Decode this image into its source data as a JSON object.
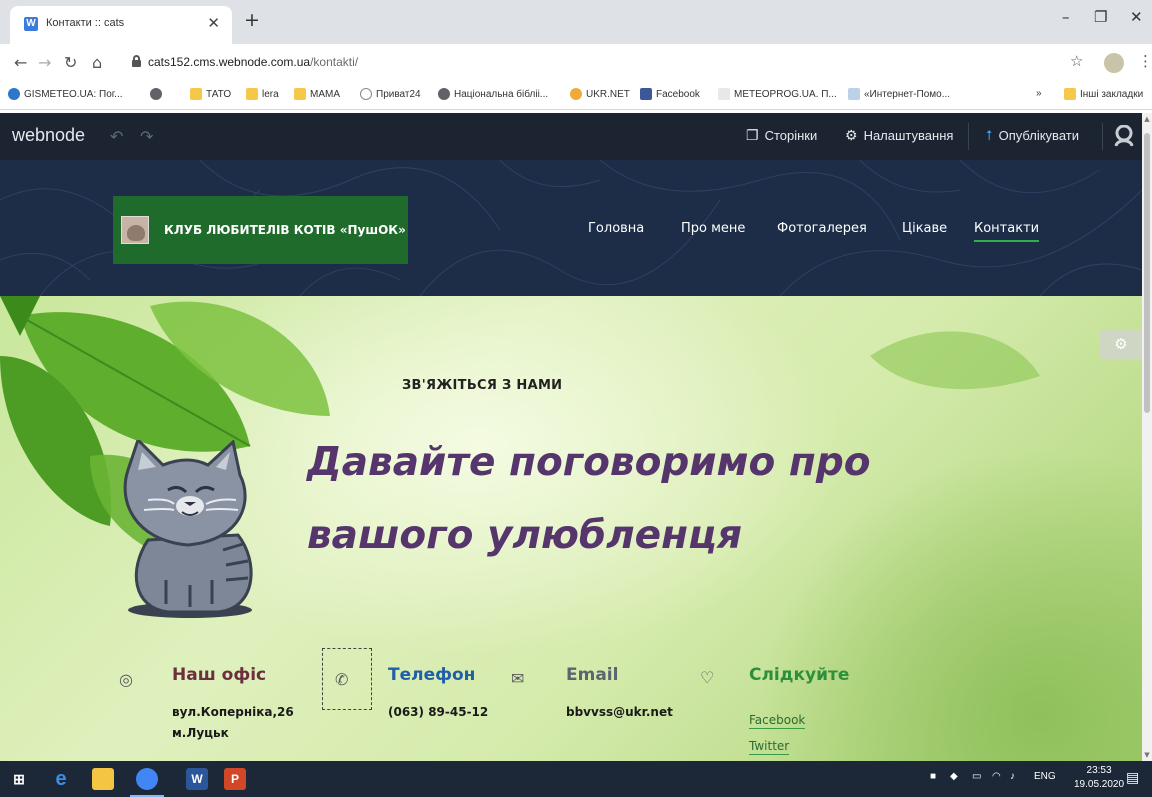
{
  "browser": {
    "tab_title": "Контакти :: cats",
    "tab_favicon": "W",
    "url_host": "cats152.cms.webnode.com.ua",
    "url_path": "/kontakti/",
    "bookmarks": [
      {
        "label": "GISMETEO.UA: Пог...",
        "icon": "gismeteo"
      },
      {
        "label": "",
        "icon": "globe"
      },
      {
        "label": "ТАТО",
        "icon": "folder"
      },
      {
        "label": "lera",
        "icon": "folder"
      },
      {
        "label": "МАМА",
        "icon": "folder"
      },
      {
        "label": "Приват24",
        "icon": "circ"
      },
      {
        "label": "Національна бібліі...",
        "icon": "globe"
      },
      {
        "label": "UKR.NET",
        "icon": "ukr"
      },
      {
        "label": "Facebook",
        "icon": "fb"
      },
      {
        "label": "METEOPROG.UA. П...",
        "icon": "meteo"
      },
      {
        "label": "«Интернет-Помо...",
        "icon": "docico"
      }
    ],
    "bookmarks_overflow": "»",
    "other_bookmarks": "Інші закладки"
  },
  "editor": {
    "logo": "webnode",
    "pages_label": "Сторінки",
    "settings_label": "Налаштування",
    "publish_label": "Опублікувати"
  },
  "site": {
    "brand_name": "КЛУБ ЛЮБИТЕЛІВ КОТІВ «ПушОК»",
    "menu": [
      "Головна",
      "Про мене",
      "Фотогалерея",
      "Цікаве",
      "Контакти"
    ],
    "active_menu": "Контакти"
  },
  "hero": {
    "eyebrow": "ЗВ'ЯЖІТЬСЯ З НАМИ",
    "headline_line1": "Давайте поговоримо про",
    "headline_line2": "вашого улюбленця"
  },
  "contacts": {
    "office": {
      "title": "Наш офіс",
      "line1": "вул.Коперніка,26",
      "line2": "м.Луцьк",
      "color": "#6b2f3e"
    },
    "phone": {
      "title": "Телефон",
      "value": "(063) 89-45-12",
      "color": "#2160a8"
    },
    "email": {
      "title": "Email",
      "value": "bbvvss@ukr.net",
      "color": "#5d6470"
    },
    "follow": {
      "title": "Слідкуйте",
      "links": [
        "Facebook",
        "Twitter"
      ],
      "color": "#2e8f3a"
    }
  },
  "taskbar": {
    "lang": "ENG",
    "time": "23:53",
    "date": "19.05.2020"
  }
}
